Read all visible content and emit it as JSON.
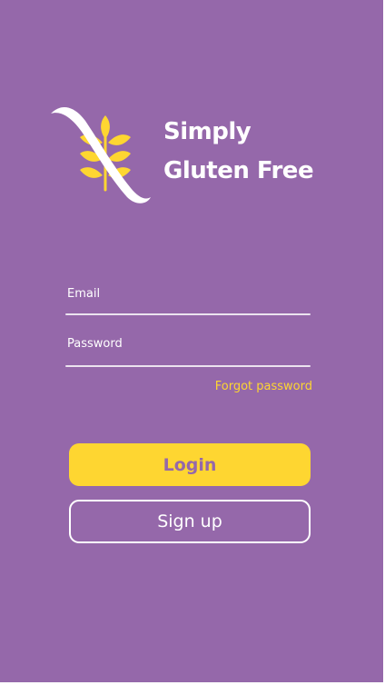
{
  "theme": {
    "background": "#9568aa",
    "accent": "#fed631",
    "text": "#ffffff"
  },
  "brand": {
    "line1": "Simply",
    "line2": "Gluten Free",
    "logo_icon": "crossed-wheat-icon"
  },
  "form": {
    "email_label": "Email",
    "email_value": "",
    "password_label": "Password",
    "password_value": "",
    "forgot_label": "Forgot password"
  },
  "actions": {
    "login_label": "Login",
    "signup_label": "Sign up"
  }
}
